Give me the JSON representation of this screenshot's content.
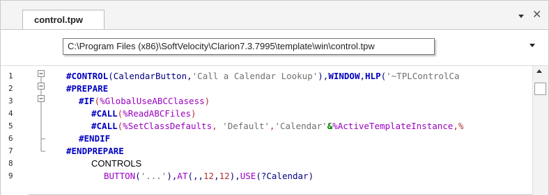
{
  "tab": {
    "label": "control.tpw"
  },
  "tooltip": {
    "path": "C:\\Program Files (x86)\\SoftVelocity\\Clarion7.3.7995\\template\\win\\control.tpw"
  },
  "line_numbers": [
    "1",
    "2",
    "3",
    "4",
    "5",
    "6",
    "7",
    "8",
    "9"
  ],
  "code": {
    "l1": [
      "#CONTROL",
      "(CalendarButton,",
      "'Call a Calendar Lookup'",
      "),",
      "WINDOW",
      ",",
      "HLP",
      "(",
      "'~TPLControlCa"
    ],
    "l2": [
      "#PREPARE"
    ],
    "l3": [
      "#IF",
      "(",
      "%GlobalUseABCClasess",
      ")"
    ],
    "l4": [
      "#CALL",
      "(",
      "%ReadABCFiles",
      ")"
    ],
    "l5": [
      "#CALL",
      "(",
      "%SetClassDefaults",
      ", ",
      "'Default'",
      ",",
      "'Calendar'",
      "&",
      "%ActiveTemplateInstance",
      ",%"
    ],
    "l6": [
      "#ENDIF"
    ],
    "l7": [
      "#ENDPREPARE"
    ],
    "l8": [
      "CONTROLS"
    ],
    "l9": [
      "BUTTON",
      "(",
      "'...'",
      "),",
      "AT",
      "(,,",
      "12",
      ",",
      "12",
      "),",
      "USE",
      "(?Calendar)"
    ]
  },
  "icons": [
    "dropdown-arrow-icon",
    "close-icon",
    "combo-dropdown-icon",
    "fold-collapse-icon",
    "scroll-up-icon"
  ],
  "colors": {
    "keyword": "#0000c0",
    "string": "#707070",
    "symbol": "#b03030",
    "accent": "#9b00c0"
  }
}
